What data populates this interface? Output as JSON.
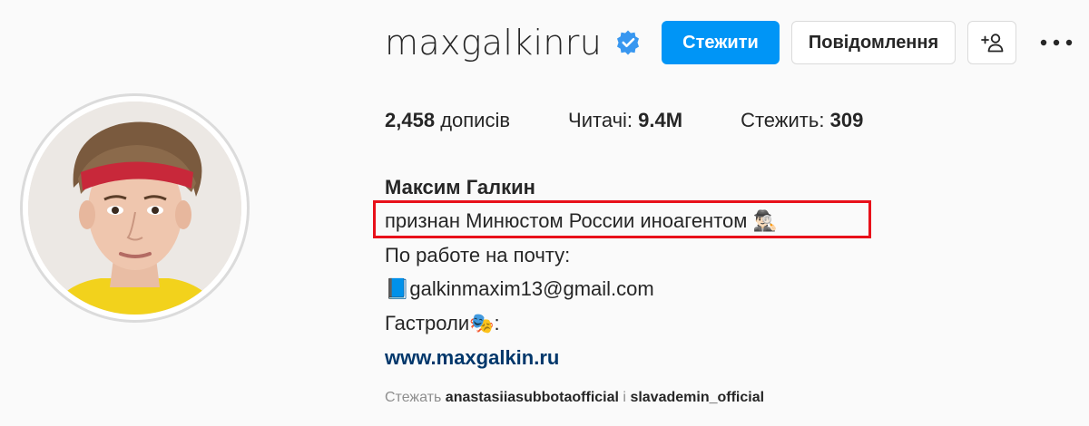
{
  "profile": {
    "username": "maxgalkinru",
    "verified": true,
    "accent_color": "#0095f6"
  },
  "actions": {
    "follow_label": "Стежити",
    "message_label": "Повідомлення",
    "suggest_icon": "person-plus-icon",
    "more_icon": "more-horizontal-icon"
  },
  "stats": {
    "posts_value": "2,458",
    "posts_label": "дописів",
    "followers_label": "Читачі:",
    "followers_value": "9.4M",
    "following_label": "Стежить:",
    "following_value": "309"
  },
  "bio": {
    "full_name": "Максим Галкин",
    "line1": "признан Минюстом России иноагентом",
    "line1_emoji": "🕵🏻‍♂️",
    "line2": "По работе на почту:",
    "line3_emoji": "📘",
    "line3": "galkinmaxim13@gmail.com",
    "line4": "Гастроли",
    "line4_emoji": "🎭",
    "line4_suffix": ":",
    "link": "www.maxgalkin.ru"
  },
  "followed_by": {
    "prefix": "Стежать",
    "user1": "anastasiiasubbotaofficial",
    "separator": "і",
    "user2": "slavademin_official"
  },
  "highlight_color": "#e8101a"
}
